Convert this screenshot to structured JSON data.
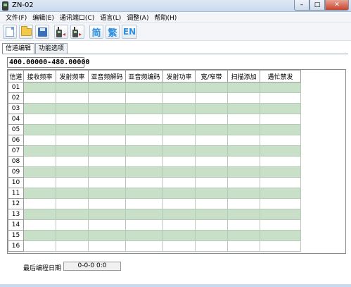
{
  "window": {
    "title": "ZN-02",
    "buttons": {
      "minimize": "–",
      "maximize": "□",
      "close": "✕"
    }
  },
  "menu": [
    "文件(F)",
    "编辑(E)",
    "通讯端口(C)",
    "语言(L)",
    "调整(A)",
    "帮助(H)"
  ],
  "toolbar": {
    "icons": [
      "new-file-icon",
      "open-folder-icon",
      "save-disk-icon",
      "read-radio-icon",
      "write-radio-icon"
    ],
    "simplified_label": "简",
    "traditional_label": "繁",
    "english_label": "EN"
  },
  "tabs": [
    {
      "label": "信道编辑",
      "active": true
    },
    {
      "label": "功能选项",
      "active": false
    }
  ],
  "frequency_range": "400.00000-480.00000",
  "grid": {
    "columns": [
      "信道",
      "接收频率",
      "发射频率",
      "亚音频解码",
      "亚音频编码",
      "发射功率",
      "宽/窄带",
      "扫描添加",
      "遇忙禁发"
    ],
    "rows": [
      "01",
      "02",
      "03",
      "04",
      "05",
      "06",
      "07",
      "08",
      "09",
      "10",
      "11",
      "12",
      "13",
      "14",
      "15",
      "16"
    ]
  },
  "status": {
    "last_program_label": "最后编程日期",
    "last_program_value": "0-0-0   0:0"
  },
  "colors": {
    "row_highlight": "#c8e0c8",
    "lang_button_text": "#2f8fe0"
  }
}
